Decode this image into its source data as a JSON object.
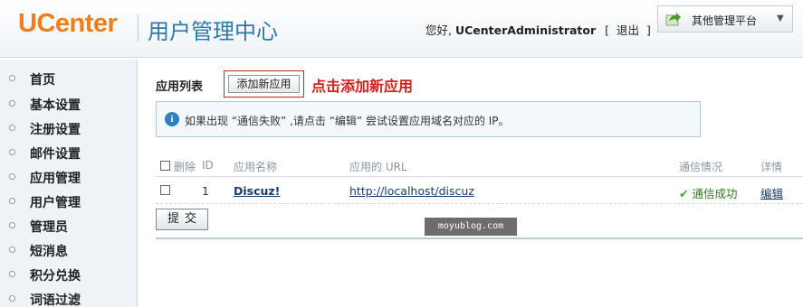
{
  "header": {
    "logo": "UCenter",
    "title": "用户管理中心",
    "greeting": "您好,",
    "username": "UCenterAdministrator",
    "logout_open": "[",
    "logout": "退出",
    "logout_close": "]",
    "platform_label": "其他管理平台"
  },
  "sidebar": {
    "items": [
      {
        "label": "首页"
      },
      {
        "label": "基本设置"
      },
      {
        "label": "注册设置"
      },
      {
        "label": "邮件设置"
      },
      {
        "label": "应用管理"
      },
      {
        "label": "用户管理"
      },
      {
        "label": "管理员"
      },
      {
        "label": "短消息"
      },
      {
        "label": "积分兑换"
      },
      {
        "label": "词语过滤"
      }
    ]
  },
  "main": {
    "section_title": "应用列表",
    "add_button": "添加新应用",
    "annotation": "点击添加新应用",
    "notice": "如果出现 “通信失败” ,请点击 “编辑” 尝试设置应用域名对应的 IP。",
    "table": {
      "headers": {
        "delete": "删除",
        "id": "ID",
        "name": "应用名称",
        "url": "应用的 URL",
        "status": "通信情况",
        "detail": "详情"
      },
      "rows": [
        {
          "id": "1",
          "name": "Discuz!",
          "url": "http://localhost/discuz",
          "status": "通信成功",
          "detail": "编辑"
        }
      ]
    },
    "submit": "提交"
  },
  "watermark": "moyublog.com"
}
